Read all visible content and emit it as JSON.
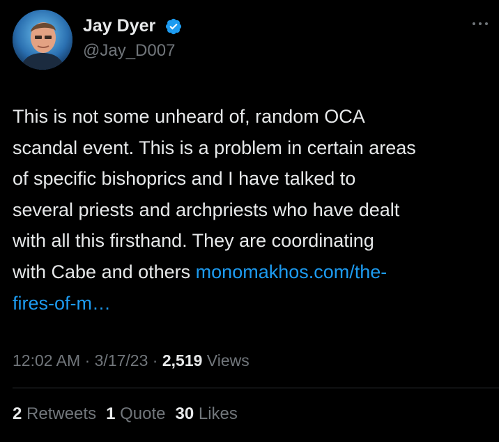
{
  "author": {
    "display_name": "Jay Dyer",
    "handle": "@Jay_D007",
    "verified_icon": "verified-badge-icon",
    "avatar_icon": "profile-photo"
  },
  "more_icon": "more-options-icon",
  "tweet": {
    "line_1": "This is not some unheard of, random OCA",
    "line_2": "scandal event. This is a problem in certain areas",
    "line_3": "of specific bishoprics and I have talked to",
    "line_4": "several priests and archpriests who have dealt",
    "line_5": "with all this firsthand.  They are coordinating",
    "line_6_text": "with Cabe and others ",
    "line_6_link": "monomakhos.com/the-",
    "line_7_link": "fires-of-m…"
  },
  "meta": {
    "time": "12:02 AM",
    "separator": " · ",
    "date": "3/17/23",
    "views_count": "2,519",
    "views_label": " Views"
  },
  "stats": {
    "retweets_count": "2",
    "retweets_label": " Retweets",
    "quotes_count": "1",
    "quotes_label": " Quote",
    "likes_count": "30",
    "likes_label": " Likes"
  },
  "colors": {
    "background": "#000000",
    "primary_text": "#e7e9ea",
    "secondary_text": "#71767b",
    "link": "#1d9bf0",
    "verified": "#1d9bf0"
  }
}
